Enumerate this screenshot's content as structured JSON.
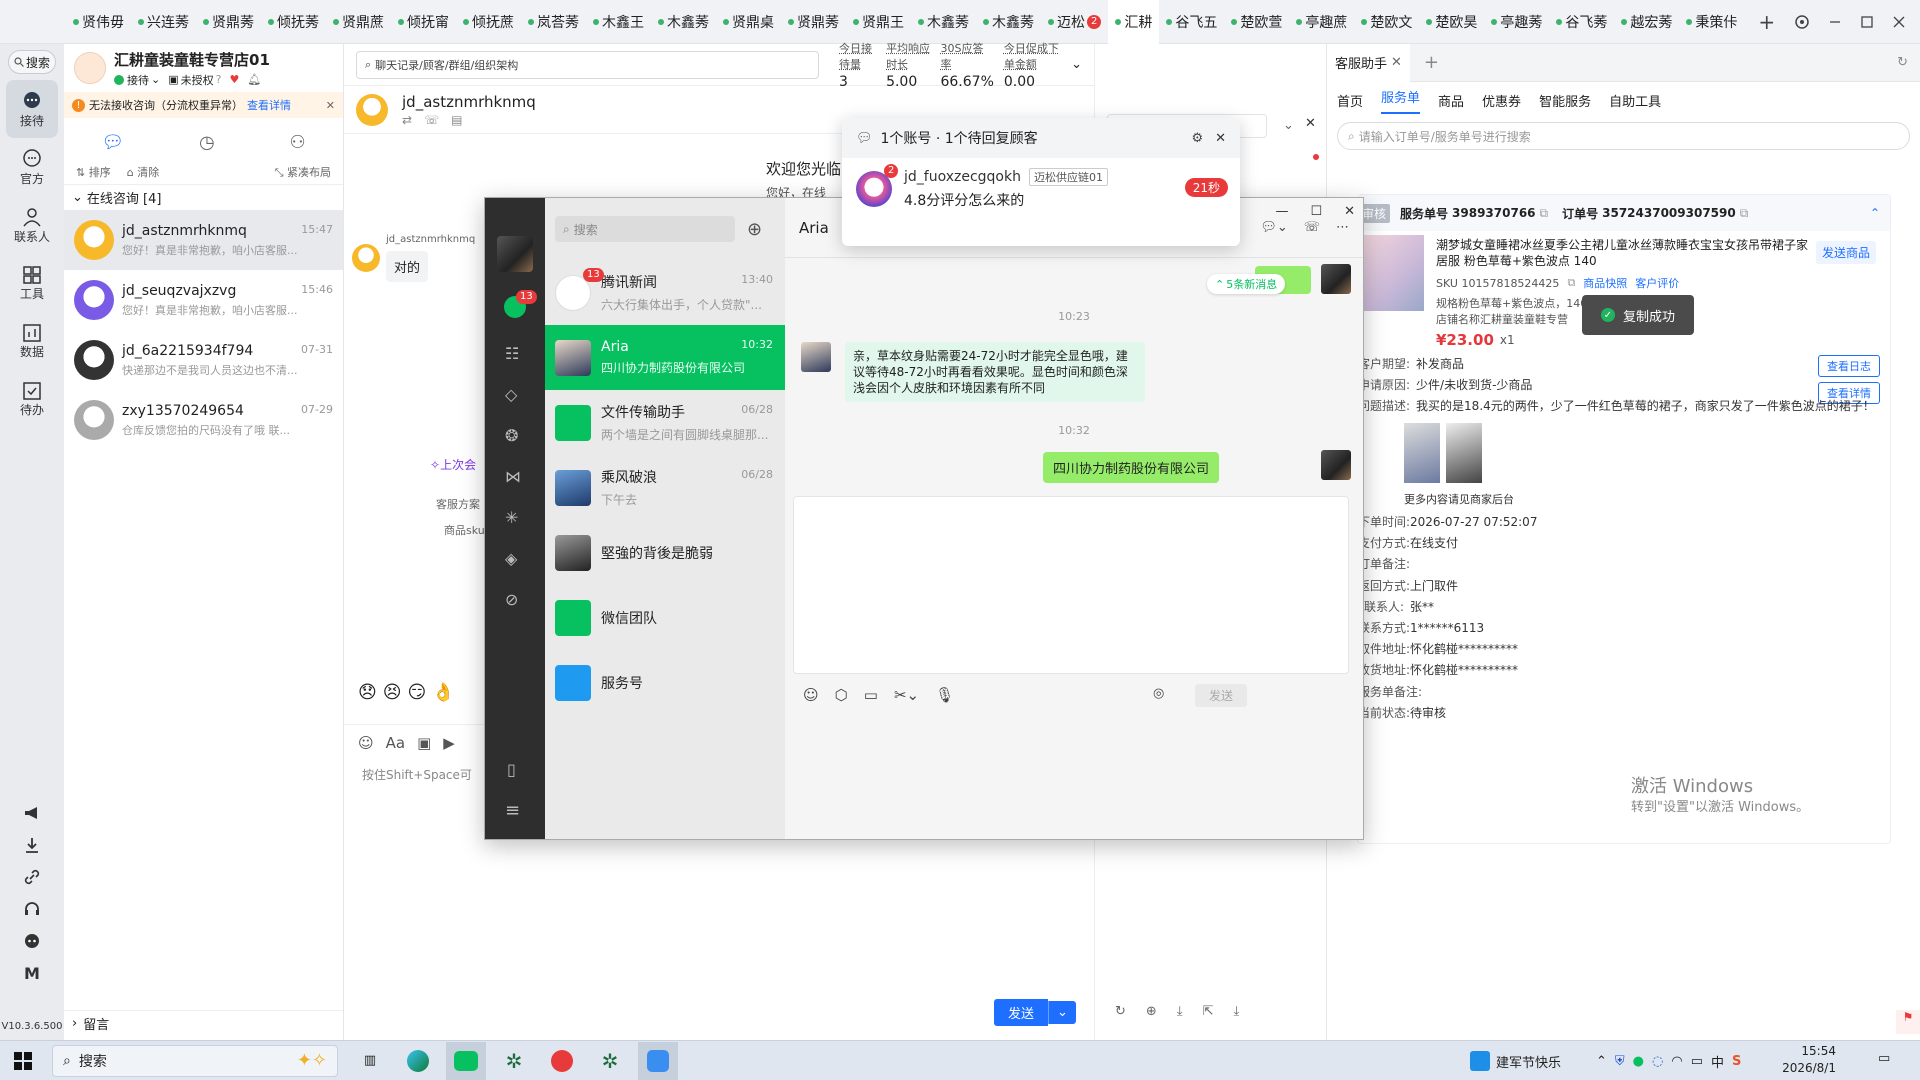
{
  "top_tabs": [
    {
      "label": "贤伟毋"
    },
    {
      "label": "兴连莠"
    },
    {
      "label": "贤鼎莠"
    },
    {
      "label": "倾抚莠"
    },
    {
      "label": "贤鼎蔗"
    },
    {
      "label": "倾抚甯"
    },
    {
      "label": "倾抚蔗"
    },
    {
      "label": "岚荅莠"
    },
    {
      "label": "木鑫王"
    },
    {
      "label": "木鑫莠"
    },
    {
      "label": "贤鼎桌"
    },
    {
      "label": "贤鼎莠"
    },
    {
      "label": "贤鼎王"
    },
    {
      "label": "木鑫莠"
    },
    {
      "label": "木鑫莠"
    },
    {
      "label": "迈松",
      "badge": "2"
    },
    {
      "label": "汇耕"
    },
    {
      "label": "谷飞五"
    },
    {
      "label": "楚欧萱"
    },
    {
      "label": "亭趣蔗"
    },
    {
      "label": "楚欧文"
    },
    {
      "label": "楚欧昊"
    },
    {
      "label": "亭趣莠"
    },
    {
      "label": "谷飞莠"
    },
    {
      "label": "越宏莠"
    },
    {
      "label": "秉策佧"
    }
  ],
  "rail": {
    "search": "搜索",
    "items": [
      "接待",
      "官方",
      "联系人",
      "工具",
      "数据",
      "待办"
    ],
    "version": "V10.3.6.500"
  },
  "store": {
    "name": "汇耕童装童鞋专营店01",
    "status": "接待",
    "auth": "未授权",
    "alert": "无法接收咨询（分流权重异常）",
    "alert_link": "查看详情",
    "sort": "排序",
    "clear": "清除",
    "layout": "紧凑布局",
    "section": "在线咨询 [4]",
    "footer": "留言"
  },
  "conversations": [
    {
      "name": "jd_astznmrhknmq",
      "time": "15:47",
      "preview": "您好！真是非常抱歉，咱小店客服..."
    },
    {
      "name": "jd_seuqzvajxzvg",
      "time": "15:46",
      "preview": "您好！真是非常抱歉，咱小店客服..."
    },
    {
      "name": "jd_6a2215934f794",
      "time": "07-31",
      "preview": "快递那边不是我司人员这边也不清..."
    },
    {
      "name": "zxy13570249654",
      "time": "07-29",
      "preview": "仓库反馈您拍的尺码没有了哦 联..."
    }
  ],
  "center": {
    "search_placeholder": "聊天记录/顾客/群组/组织架构",
    "stats": [
      {
        "label": "今日接待量",
        "value": "3"
      },
      {
        "label": "平均响应时长",
        "value": "5.00"
      },
      {
        "label": "30S应答率",
        "value": "66.67%"
      },
      {
        "label": "今日促成下单金额",
        "value": "0.00"
      }
    ],
    "customer": "jd_astznmrhknmq",
    "welcome": "欢迎您光临",
    "welcome2": "您好，在线",
    "msg_sender": "jd_astznmrhknmq",
    "msg_text": "对的",
    "last_session": "上次会",
    "plan_label": "客服方案",
    "sku_label": "商品sku",
    "input_hint": "按住Shift+Space可",
    "send": "发送",
    "card": "卡片"
  },
  "popup": {
    "title": "1个账号 · 1个待回复顾客",
    "user": "jd_fuoxzecgqokh",
    "tag": "迈松供应链01",
    "msg": "4.8分评分怎么来的",
    "timer": "21秒",
    "badge": "2"
  },
  "wechat": {
    "search": "搜索",
    "chat_title": "Aria",
    "new_msgs": "5条新消息",
    "time1": "10:23",
    "msg1": "亲，草本纹身贴需要24-72小时才能完全显色哦，建议等待48-72小时再看看效果呢。显色时间和颜色深浅会因个人皮肤和环境因素有所不同",
    "time2": "10:32",
    "msg2": "四川协力制药股份有限公司",
    "send": "发送",
    "left_badge": "13",
    "items": [
      {
        "name": "腾讯新闻",
        "time": "13:40",
        "preview": "六大行集体出手，个人贷款\"...",
        "badge": "13"
      },
      {
        "name": "Aria",
        "time": "10:32",
        "preview": "四川协力制药股份有限公司"
      },
      {
        "name": "文件传输助手",
        "time": "06/28",
        "preview": "两个墙是之间有圆脚线桌腿那..."
      },
      {
        "name": "乘风破浪",
        "time": "06/28",
        "preview": "下午去"
      },
      {
        "name": "堅強的背後是脆弱",
        "time": "",
        "preview": ""
      },
      {
        "name": "微信团队",
        "time": "",
        "preview": ""
      },
      {
        "name": "服务号",
        "time": "",
        "preview": ""
      }
    ]
  },
  "right": {
    "tab_title": "客服助手",
    "nav": [
      "首页",
      "服务单",
      "商品",
      "优惠券",
      "智能服务",
      "自助工具"
    ],
    "search_placeholder": "请输入订单号/服务单号进行搜索",
    "status_tag": "审核",
    "service_no_label": "服务单号",
    "service_no": "3989370766",
    "order_no_label": "订单号",
    "order_no": "3572437009307590",
    "product_title": "潮梦城女童睡裙冰丝夏季公主裙儿童冰丝薄款睡衣宝宝女孩吊带裙子家居服 粉色草莓+紫色波点 140",
    "send_product": "发送商品",
    "sku": "SKU 10157818524425",
    "snapshot": "商品快照",
    "review": "客户评价",
    "spec": "规格粉色草莓+紫色波点，140",
    "shop": "店铺名称汇耕童装童鞋专营",
    "price": "¥23.00",
    "qty": "x1",
    "toast": "复制成功",
    "view_log": "查看日志",
    "view_detail": "查看详情",
    "rows": [
      {
        "label": "客户期望:",
        "value": "补发商品"
      },
      {
        "label": "申请原因:",
        "value": "少件/未收到货-少商品"
      },
      {
        "label": "问题描述:",
        "value": "我买的是18.4元的两件，少了一件红色草莓的裙子，商家只发了一件紫色波点的裙子！"
      }
    ],
    "more": "更多内容请见商家后台",
    "details": [
      {
        "label": "下单时间:",
        "value": "2026-07-27 07:52:07"
      },
      {
        "label": "支付方式:",
        "value": "在线支付"
      },
      {
        "label": "订单备注:",
        "value": ""
      },
      {
        "label": "返回方式:",
        "value": "上门取件"
      },
      {
        "label": "联系人:",
        "value": "张**"
      },
      {
        "label": "联系方式:",
        "value": "1******6113"
      },
      {
        "label": "取件地址:",
        "value": "怀化鹤椪**********"
      },
      {
        "label": "收货地址:",
        "value": "怀化鹤椪**********"
      },
      {
        "label": "服务单备注:",
        "value": ""
      },
      {
        "label": "当前状态:",
        "value": "待审核"
      }
    ],
    "activate1": "激活 Windows",
    "activate2": "转到\"设置\"以激活 Windows。"
  },
  "taskbar": {
    "search": "搜索",
    "festival": "建军节快乐",
    "ime": "中",
    "time": "15:54",
    "date": "2026/8/1"
  },
  "colors": {
    "accent": "#1e6fff",
    "wechat_green": "#07c160",
    "danger": "#e83a3a",
    "price": "#e4393c"
  }
}
